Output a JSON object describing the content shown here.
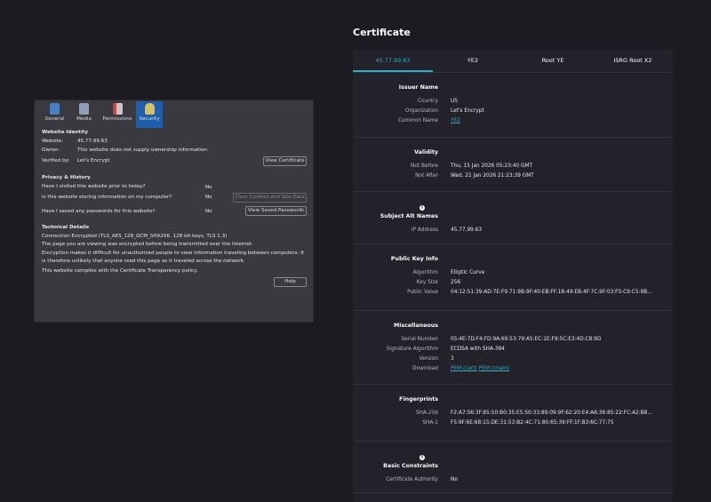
{
  "dialog": {
    "tabs": [
      {
        "label": "General",
        "color": "#4a7fc0"
      },
      {
        "label": "Media",
        "color": "#8ea0b8"
      },
      {
        "label": "Permissions",
        "color": "#c44"
      },
      {
        "label": "Security",
        "color": "#d8c060"
      }
    ],
    "identity_heading": "Website Identity",
    "website_label": "Website:",
    "website_value": "45.77.99.63",
    "owner_label": "Owner:",
    "owner_value": "This website does not supply ownership information.",
    "verified_label": "Verified by:",
    "verified_value": "Let's Encrypt",
    "view_certificate": "View Certificate",
    "privacy_heading": "Privacy & History",
    "q1": "Have I visited this website prior to today?",
    "a1": "No",
    "q2": "Is this website storing information on my computer?",
    "a2": "No",
    "clear_cookies": "Clear Cookies and Site Data",
    "q3": "Have I saved any passwords for this website?",
    "a3": "No",
    "view_passwords": "View Saved Passwords",
    "tech_heading": "Technical Details",
    "t1": "Connection Encrypted (TLS_AES_128_GCM_SHA256, 128 bit keys, TLS 1.3)",
    "t2": "The page you are viewing was encrypted before being transmitted over the Internet.",
    "t3": "Encryption makes it difficult for unauthorized people to view information traveling between computers. It",
    "t4": "is therefore unlikely that anyone read this page as it traveled across the network.",
    "t5": "This website complies with the Certificate Transparency policy.",
    "help": "Help"
  },
  "certificate": {
    "title": "Certificate",
    "tabs": [
      "45.77.99.63",
      "YE2",
      "Root YE",
      "ISRG Root X2"
    ],
    "accent": "#2ab0c0",
    "sections": [
      {
        "heading": "Issuer Name",
        "rows": [
          [
            "Country",
            "US"
          ],
          [
            "Organization",
            "Let's Encrypt"
          ],
          [
            "Common Name",
            "YE2"
          ]
        ]
      },
      {
        "heading": "Validity",
        "rows": [
          [
            "Not Before",
            "Thu, 15 Jan 2026 05:23:40 GMT"
          ],
          [
            "Not After",
            "Wed, 21 Jan 2026 21:23:39 GMT"
          ]
        ]
      },
      {
        "heading": "Subject Alt Names",
        "info": true,
        "rows": [
          [
            "IP Address",
            "45.77.99.63"
          ]
        ]
      },
      {
        "heading": "Public Key Info",
        "rows": [
          [
            "Algorithm",
            "Elliptic Curve"
          ],
          [
            "Key Size",
            "256"
          ],
          [
            "Public Value",
            "04:12:51:39:AD:7E:F9:71:9B:9F:40:EB:FF:1B:49:EB:4F:7C:9F:03:F5:C9:C5:9B..."
          ]
        ]
      },
      {
        "heading": "Miscellaneous",
        "rows": [
          [
            "Serial Number",
            "05:4E:7D:F4:FD:9A:69:53:79:A5:EC:1E:F9:5C:E3:4D:C8:9D"
          ],
          [
            "Signature Algorithm",
            "ECDSA with SHA-384"
          ],
          [
            "Version",
            "3"
          ],
          [
            "Download",
            "PEM (cert)",
            "PEM (chain)"
          ]
        ]
      },
      {
        "heading": "Fingerprints",
        "rows": [
          [
            "SHA-256",
            "F2:A7:56:3F:85:50:B0:35:E5:50:33:89:09:9F:62:20:E4:A6:36:85:22:FC:A2:B8..."
          ],
          [
            "SHA-1",
            "F5:9F:6E:68:15:DE:31:53:B2:4C:71:80:65:39:FF:1F:B3:6C:77:75"
          ]
        ]
      },
      {
        "heading": "Basic Constraints",
        "info": true,
        "rows": [
          [
            "Certificate Authority",
            "No"
          ]
        ]
      }
    ]
  }
}
